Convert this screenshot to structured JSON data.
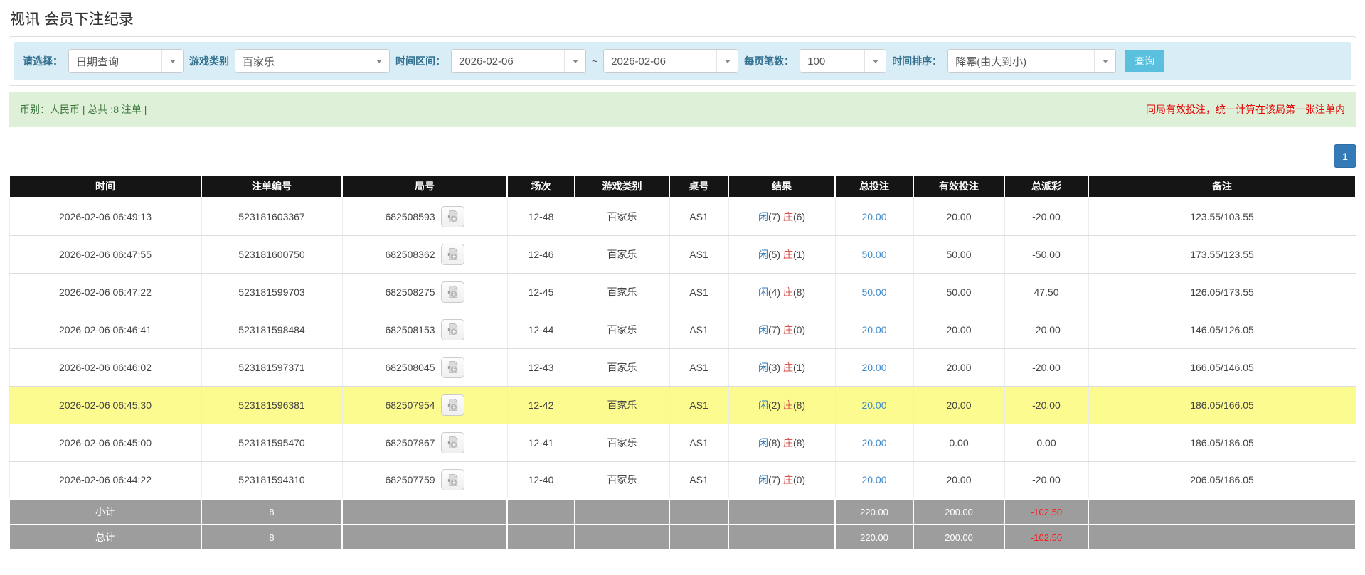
{
  "page": {
    "title": "视讯 会员下注纪录"
  },
  "filters": {
    "choose_label": "请选择：",
    "choose_value": "日期查询",
    "game_type_label": "游戏类别",
    "game_type_value": "百家乐",
    "time_range_label": "时间区间：",
    "date_from": "2026-02-06",
    "date_separator": "~",
    "date_to": "2026-02-06",
    "page_size_label": "每页笔数：",
    "page_size_value": "100",
    "sort_label": "时间排序：",
    "sort_value": "降幂(由大到小)",
    "search_button": "查询"
  },
  "summary": {
    "left_text": "币别：人民币 | 总共 :8 注单 |",
    "right_text": "同局有效投注，统一计算在该局第一张注单内"
  },
  "pagination": {
    "current_page": "1"
  },
  "table": {
    "columns": [
      "时间",
      "注单编号",
      "局号",
      "场次",
      "游戏类别",
      "桌号",
      "结果",
      "总投注",
      "有效投注",
      "总派彩",
      "备注"
    ],
    "video_icon": "video-replay-icon",
    "rows": [
      {
        "time": "2026-02-06 06:49:13",
        "bet_id": "523181603367",
        "round_no": "682508593",
        "session": "12-48",
        "game_type": "百家乐",
        "table_no": "AS1",
        "result": {
          "player_label": "闲",
          "player_score": "(7)",
          "banker_label": "庄",
          "banker_score": "(6)"
        },
        "total_bet": "20.00",
        "valid_bet": "20.00",
        "payout": "-20.00",
        "remark": "123.55/103.55",
        "highlighted": false
      },
      {
        "time": "2026-02-06 06:47:55",
        "bet_id": "523181600750",
        "round_no": "682508362",
        "session": "12-46",
        "game_type": "百家乐",
        "table_no": "AS1",
        "result": {
          "player_label": "闲",
          "player_score": "(5)",
          "banker_label": "庄",
          "banker_score": "(1)"
        },
        "total_bet": "50.00",
        "valid_bet": "50.00",
        "payout": "-50.00",
        "remark": "173.55/123.55",
        "highlighted": false
      },
      {
        "time": "2026-02-06 06:47:22",
        "bet_id": "523181599703",
        "round_no": "682508275",
        "session": "12-45",
        "game_type": "百家乐",
        "table_no": "AS1",
        "result": {
          "player_label": "闲",
          "player_score": "(4)",
          "banker_label": "庄",
          "banker_score": "(8)"
        },
        "total_bet": "50.00",
        "valid_bet": "50.00",
        "payout": "47.50",
        "remark": "126.05/173.55",
        "highlighted": false
      },
      {
        "time": "2026-02-06 06:46:41",
        "bet_id": "523181598484",
        "round_no": "682508153",
        "session": "12-44",
        "game_type": "百家乐",
        "table_no": "AS1",
        "result": {
          "player_label": "闲",
          "player_score": "(7)",
          "banker_label": "庄",
          "banker_score": "(0)"
        },
        "total_bet": "20.00",
        "valid_bet": "20.00",
        "payout": "-20.00",
        "remark": "146.05/126.05",
        "highlighted": false
      },
      {
        "time": "2026-02-06 06:46:02",
        "bet_id": "523181597371",
        "round_no": "682508045",
        "session": "12-43",
        "game_type": "百家乐",
        "table_no": "AS1",
        "result": {
          "player_label": "闲",
          "player_score": "(3)",
          "banker_label": "庄",
          "banker_score": "(1)"
        },
        "total_bet": "20.00",
        "valid_bet": "20.00",
        "payout": "-20.00",
        "remark": "166.05/146.05",
        "highlighted": false
      },
      {
        "time": "2026-02-06 06:45:30",
        "bet_id": "523181596381",
        "round_no": "682507954",
        "session": "12-42",
        "game_type": "百家乐",
        "table_no": "AS1",
        "result": {
          "player_label": "闲",
          "player_score": "(2)",
          "banker_label": "庄",
          "banker_score": "(8)"
        },
        "total_bet": "20.00",
        "valid_bet": "20.00",
        "payout": "-20.00",
        "remark": "186.05/166.05",
        "highlighted": true
      },
      {
        "time": "2026-02-06 06:45:00",
        "bet_id": "523181595470",
        "round_no": "682507867",
        "session": "12-41",
        "game_type": "百家乐",
        "table_no": "AS1",
        "result": {
          "player_label": "闲",
          "player_score": "(8)",
          "banker_label": "庄",
          "banker_score": "(8)"
        },
        "total_bet": "20.00",
        "valid_bet": "0.00",
        "payout": "0.00",
        "remark": "186.05/186.05",
        "highlighted": false
      },
      {
        "time": "2026-02-06 06:44:22",
        "bet_id": "523181594310",
        "round_no": "682507759",
        "session": "12-40",
        "game_type": "百家乐",
        "table_no": "AS1",
        "result": {
          "player_label": "闲",
          "player_score": "(7)",
          "banker_label": "庄",
          "banker_score": "(0)"
        },
        "total_bet": "20.00",
        "valid_bet": "20.00",
        "payout": "-20.00",
        "remark": "206.05/186.05",
        "highlighted": false
      }
    ],
    "footer": [
      {
        "label": "小计",
        "count": "8",
        "total_bet": "220.00",
        "valid_bet": "200.00",
        "payout": "-102.50",
        "remark": ""
      },
      {
        "label": "总计",
        "count": "8",
        "total_bet": "220.00",
        "valid_bet": "200.00",
        "payout": "-102.50",
        "remark": ""
      }
    ]
  },
  "colors": {
    "filter_bar_bg": "#d9edf7",
    "filter_label": "#31708f",
    "search_button": "#5bc0de",
    "summary_bg": "#dff0d8",
    "summary_text": "#3c763d",
    "negative_red": "#e60000",
    "link_blue": "#428bca",
    "player_blue": "#337ab7",
    "banker_red": "#d9534f",
    "highlight_row": "#fbfb8f",
    "pagination_active": "#337ab7"
  }
}
